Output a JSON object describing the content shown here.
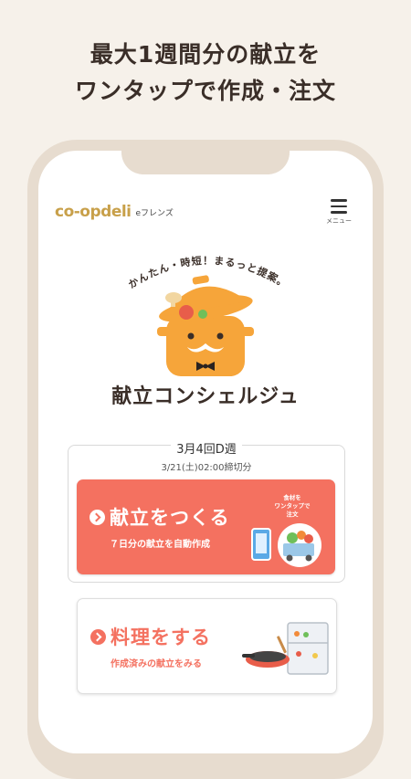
{
  "promo": {
    "line1": "最大1週間分の献立を",
    "line2": "ワンタップで作成・注文"
  },
  "header": {
    "logo_main": "co-opdeli",
    "logo_sub": "eフレンズ",
    "menu_label": "メニュー"
  },
  "hero": {
    "tagline": "かんたん・時短！まるっと提案。",
    "title": "献立コンシェルジュ"
  },
  "week": {
    "title": "3月4回D週",
    "deadline": "3/21(土)02:00締切分"
  },
  "create": {
    "label": "献立をつくる",
    "sub": "７日分の献立を自動作成",
    "badge_l1": "食材を",
    "badge_l2": "ワンタップで",
    "badge_l3": "注文"
  },
  "cook": {
    "label": "料理をする",
    "sub": "作成済みの献立をみる"
  },
  "colors": {
    "accent": "#f47160",
    "background": "#f6f1ea",
    "pot": "#f6a53a",
    "logo": "#c8a04a"
  }
}
